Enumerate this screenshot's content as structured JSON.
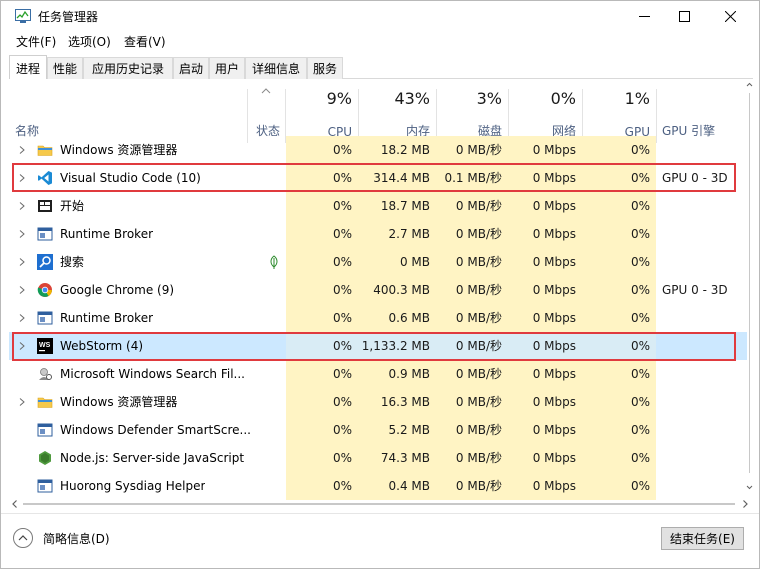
{
  "window": {
    "title": "任务管理器",
    "buttons": {
      "minimize": "—",
      "maximize": "☐",
      "close": "✕"
    }
  },
  "menu": [
    "文件(F)",
    "选项(O)",
    "查看(V)"
  ],
  "tabs": [
    "进程",
    "性能",
    "应用历史记录",
    "启动",
    "用户",
    "详细信息",
    "服务"
  ],
  "active_tab": "进程",
  "columns": {
    "name": "名称",
    "status": "状态",
    "cpu": {
      "pct": "9%",
      "label": "CPU"
    },
    "memory": {
      "pct": "43%",
      "label": "内存"
    },
    "disk": {
      "pct": "3%",
      "label": "磁盘"
    },
    "network": {
      "pct": "0%",
      "label": "网络"
    },
    "gpu": {
      "pct": "1%",
      "label": "GPU"
    },
    "gpu_engine": "GPU 引擎"
  },
  "rows": [
    {
      "name": "Windows 资源管理器",
      "icon": "explorer-folder-icon",
      "expandable": true,
      "cpu": "0%",
      "mem": "18.2 MB",
      "disk": "0 MB/秒",
      "net": "0 Mbps",
      "gpu": "0%",
      "engine": ""
    },
    {
      "name": "Visual Studio Code (10)",
      "icon": "vscode-icon",
      "expandable": true,
      "cpu": "0%",
      "mem": "314.4 MB",
      "disk": "0.1 MB/秒",
      "net": "0 Mbps",
      "gpu": "0%",
      "engine": "GPU 0 - 3D"
    },
    {
      "name": "开始",
      "icon": "start-icon",
      "expandable": true,
      "cpu": "0%",
      "mem": "18.7 MB",
      "disk": "0 MB/秒",
      "net": "0 Mbps",
      "gpu": "0%",
      "engine": ""
    },
    {
      "name": "Runtime Broker",
      "icon": "window-app-icon",
      "expandable": true,
      "cpu": "0%",
      "mem": "2.7 MB",
      "disk": "0 MB/秒",
      "net": "0 Mbps",
      "gpu": "0%",
      "engine": ""
    },
    {
      "name": "搜索",
      "icon": "search-icon",
      "expandable": true,
      "suspended": true,
      "cpu": "0%",
      "mem": "0 MB",
      "disk": "0 MB/秒",
      "net": "0 Mbps",
      "gpu": "0%",
      "engine": ""
    },
    {
      "name": "Google Chrome (9)",
      "icon": "chrome-icon",
      "expandable": true,
      "cpu": "0%",
      "mem": "400.3 MB",
      "disk": "0 MB/秒",
      "net": "0 Mbps",
      "gpu": "0%",
      "engine": "GPU 0 - 3D"
    },
    {
      "name": "Runtime Broker",
      "icon": "window-app-icon",
      "expandable": true,
      "cpu": "0%",
      "mem": "0.6 MB",
      "disk": "0 MB/秒",
      "net": "0 Mbps",
      "gpu": "0%",
      "engine": ""
    },
    {
      "name": "WebStorm (4)",
      "icon": "webstorm-icon",
      "expandable": true,
      "selected": true,
      "cpu": "0%",
      "mem": "1,133.2 MB",
      "disk": "0 MB/秒",
      "net": "0 Mbps",
      "gpu": "0%",
      "engine": ""
    },
    {
      "name": "Microsoft Windows Search Fil...",
      "icon": "search-filter-icon",
      "expandable": false,
      "cpu": "0%",
      "mem": "0.9 MB",
      "disk": "0 MB/秒",
      "net": "0 Mbps",
      "gpu": "0%",
      "engine": ""
    },
    {
      "name": "Windows 资源管理器",
      "icon": "explorer-folder-icon",
      "expandable": true,
      "cpu": "0%",
      "mem": "16.3 MB",
      "disk": "0 MB/秒",
      "net": "0 Mbps",
      "gpu": "0%",
      "engine": ""
    },
    {
      "name": "Windows Defender SmartScre...",
      "icon": "window-app-icon",
      "expandable": false,
      "cpu": "0%",
      "mem": "5.2 MB",
      "disk": "0 MB/秒",
      "net": "0 Mbps",
      "gpu": "0%",
      "engine": ""
    },
    {
      "name": "Node.js: Server-side JavaScript",
      "icon": "nodejs-icon",
      "expandable": false,
      "cpu": "0%",
      "mem": "74.3 MB",
      "disk": "0 MB/秒",
      "net": "0 Mbps",
      "gpu": "0%",
      "engine": ""
    },
    {
      "name": "Huorong Sysdiag Helper",
      "icon": "window-app-icon",
      "expandable": false,
      "cpu": "0%",
      "mem": "0.4 MB",
      "disk": "0 MB/秒",
      "net": "0 Mbps",
      "gpu": "0%",
      "engine": ""
    }
  ],
  "footer": {
    "fewer_details": "简略信息(D)",
    "end_task": "结束任务(E)"
  },
  "colors": {
    "highlight": "#e03a3e",
    "selected_row": "#cce8ff",
    "heat_light": "#fff4c4",
    "heat_medium": "#ffe897"
  }
}
